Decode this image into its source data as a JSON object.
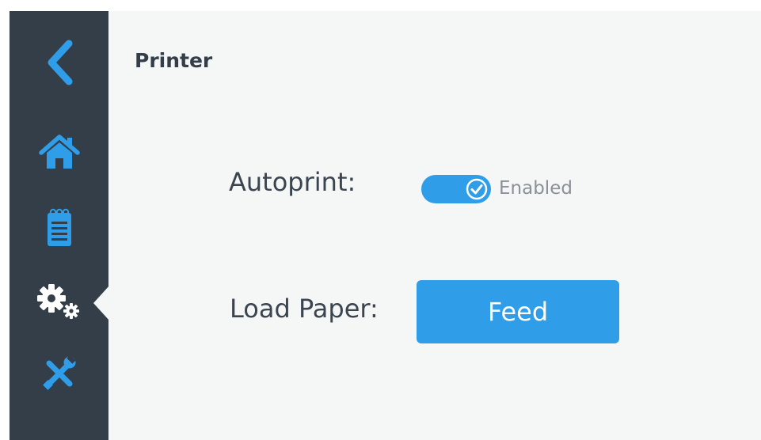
{
  "sidebar": {
    "items": [
      {
        "id": "back",
        "icon": "chevron-left-icon"
      },
      {
        "id": "home",
        "icon": "home-icon"
      },
      {
        "id": "notes",
        "icon": "notepad-icon"
      },
      {
        "id": "settings",
        "icon": "gears-icon",
        "active": true
      },
      {
        "id": "tools",
        "icon": "tools-icon"
      }
    ],
    "background_color": "#333e48",
    "icon_color": "#2f9de8"
  },
  "page": {
    "title": "Printer"
  },
  "settings": {
    "autoprint": {
      "label": "Autoprint:",
      "enabled": true,
      "status_text": "Enabled"
    },
    "load_paper": {
      "label": "Load Paper:",
      "button_label": "Feed"
    }
  },
  "colors": {
    "accent": "#2f9de8",
    "content_background": "#f5f6f6",
    "label_text": "#3b4550",
    "status_text": "#8a9198"
  }
}
